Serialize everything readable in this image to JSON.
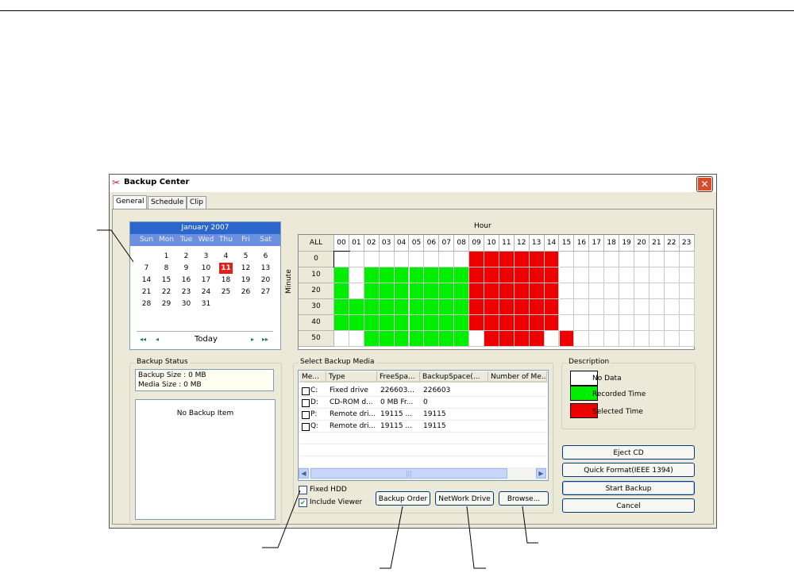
{
  "window": {
    "title": "Backup Center",
    "close_label": "✕"
  },
  "tabs": [
    {
      "label": "General",
      "active": true
    },
    {
      "label": "Schedule",
      "active": false
    },
    {
      "label": "Clip",
      "active": false
    }
  ],
  "calendar": {
    "month_label": "January 2007",
    "days_of_week": [
      "Sun",
      "Mon",
      "Tue",
      "Wed",
      "Thu",
      "Fri",
      "Sat"
    ],
    "weeks": [
      [
        "",
        "1",
        "2",
        "3",
        "4",
        "5",
        "6"
      ],
      [
        "7",
        "8",
        "9",
        "10",
        "11",
        "12",
        "13"
      ],
      [
        "14",
        "15",
        "16",
        "17",
        "18",
        "19",
        "20"
      ],
      [
        "21",
        "22",
        "23",
        "24",
        "25",
        "26",
        "27"
      ],
      [
        "28",
        "29",
        "30",
        "31",
        "",
        "",
        ""
      ]
    ],
    "selected_day": "11",
    "today_label": "Today",
    "nav": {
      "prev_year": "◂◂",
      "prev_month": "◂",
      "next_month": "▸",
      "next_year": "▸▸"
    }
  },
  "schedule": {
    "hour_label": "Hour",
    "minute_label": "Minute",
    "all_label": "ALL",
    "hours": [
      "00",
      "01",
      "02",
      "03",
      "04",
      "05",
      "06",
      "07",
      "08",
      "09",
      "10",
      "11",
      "12",
      "13",
      "14",
      "15",
      "16",
      "17",
      "18",
      "19",
      "20",
      "21",
      "22",
      "23"
    ],
    "minutes": [
      "0",
      "10",
      "20",
      "30",
      "40",
      "50"
    ],
    "state_legend": {
      "N": "No Data",
      "R": "Recorded Time",
      "S": "Selected Time"
    },
    "colors": {
      "N": "#ffffff",
      "R": "#00ee00",
      "S": "#ee0000"
    },
    "rows": [
      "NNNNNNNNNSSSSSSNNNNNNNNN",
      "RNRRRRRRRSSSSSSNNNNNNNNN",
      "RNRRRRRRRSSSSSSNNNNNNNNN",
      "RRRRRRRRRSSSSSSNNNNNNNNN",
      "RRRRRRRRRSSSSSSNNNNNNNNN",
      "NNRRRRRRRNSSSSNSNNNNNNNN"
    ]
  },
  "backup_status": {
    "title": "Backup Status",
    "backup_size": "Backup Size : 0 MB",
    "media_size": "Media Size : 0 MB",
    "empty_text": "No Backup Item"
  },
  "media": {
    "title": "Select Backup Media",
    "columns": [
      "Me...",
      "Type",
      "FreeSpa...",
      "BackupSpace(...",
      "Number of Me..."
    ],
    "rows": [
      {
        "drive": "C:",
        "type": "Fixed drive",
        "free": "226603...",
        "backup": "226603",
        "number": ""
      },
      {
        "drive": "D:",
        "type": "CD-ROM d...",
        "free": "0 MB Fr...",
        "backup": "0",
        "number": ""
      },
      {
        "drive": "P:",
        "type": "Remote dri...",
        "free": "19115 ...",
        "backup": "19115",
        "number": ""
      },
      {
        "drive": "Q:",
        "type": "Remote dri...",
        "free": "19115 ...",
        "backup": "19115",
        "number": ""
      }
    ],
    "scroll_thumb": "|||"
  },
  "options": {
    "fixed_hdd": {
      "label": "Fixed HDD",
      "checked": false
    },
    "include_viewer": {
      "label": "Include Viewer",
      "checked": true
    }
  },
  "buttons": {
    "backup_order": "Backup Order",
    "network_drive": "NetWork Drive",
    "browse": "Browse...",
    "eject_cd": "Eject CD",
    "quick_format": "Quick Format(IEEE 1394)",
    "start_backup": "Start Backup",
    "cancel": "Cancel"
  },
  "description": {
    "title": "Description",
    "items": [
      {
        "label": "No Data",
        "color": "#ffffff"
      },
      {
        "label": "Recorded Time",
        "color": "#00ee00"
      },
      {
        "label": "Selected Time",
        "color": "#ee0000"
      }
    ]
  }
}
